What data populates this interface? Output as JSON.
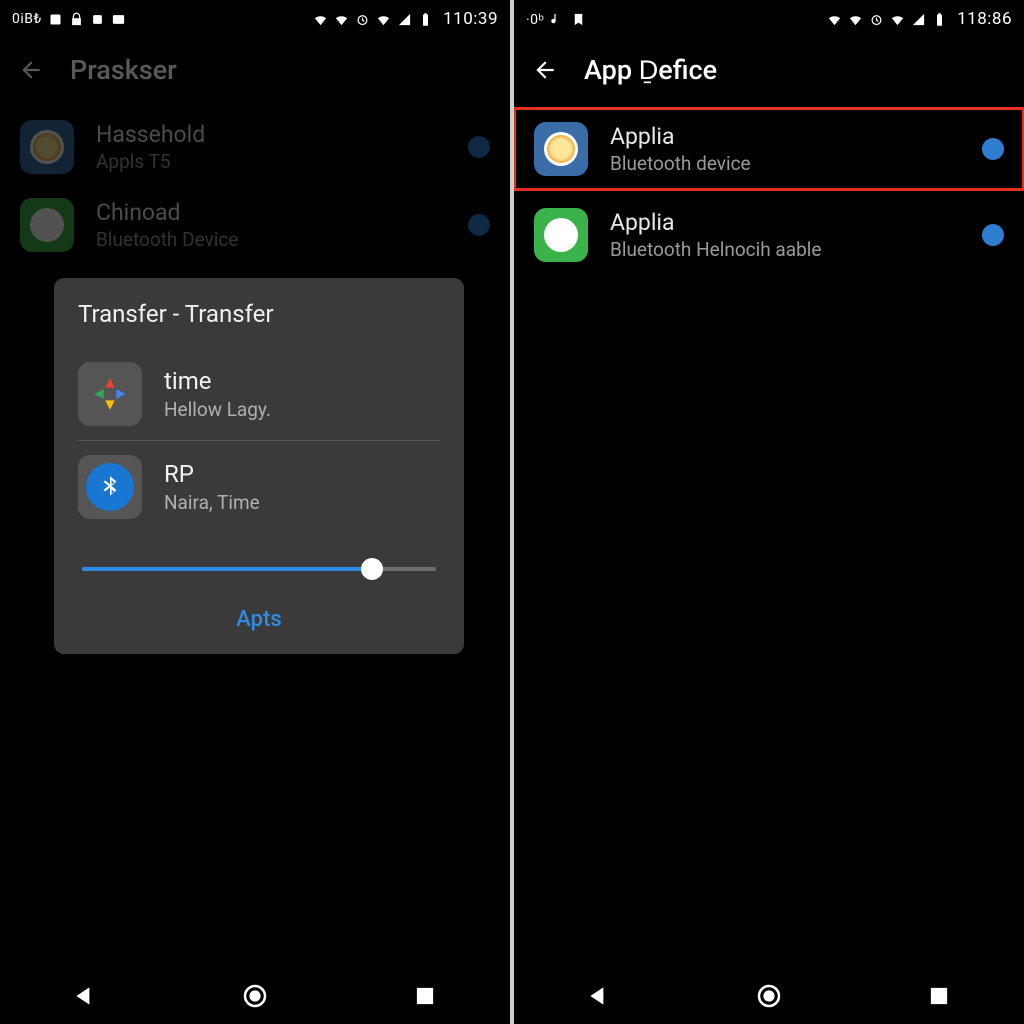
{
  "left": {
    "status": {
      "left_text": "0iB₺",
      "time": "110:39"
    },
    "appbar_title": "Praskser",
    "rows": [
      {
        "title": "Hassehold",
        "subtitle": "Appls T5"
      },
      {
        "title": "Chinoad",
        "subtitle": "Bluetooth Device"
      }
    ],
    "dialog": {
      "title": "Transfer - Transfer",
      "rows": [
        {
          "title": "time",
          "subtitle": "Hellow Lagy."
        },
        {
          "title": "RP",
          "subtitle": "Naira, Time"
        }
      ],
      "slider_percent": 82,
      "action": "Apts"
    }
  },
  "right": {
    "status": {
      "left_text": "·0ᵇ",
      "time": "118:86"
    },
    "appbar_title": "App Ḏefice",
    "rows": [
      {
        "title": "Applia",
        "subtitle": "Bluetooth device",
        "highlight": true
      },
      {
        "title": "Applia",
        "subtitle": "Bluetooth Helnocih aable"
      }
    ]
  }
}
